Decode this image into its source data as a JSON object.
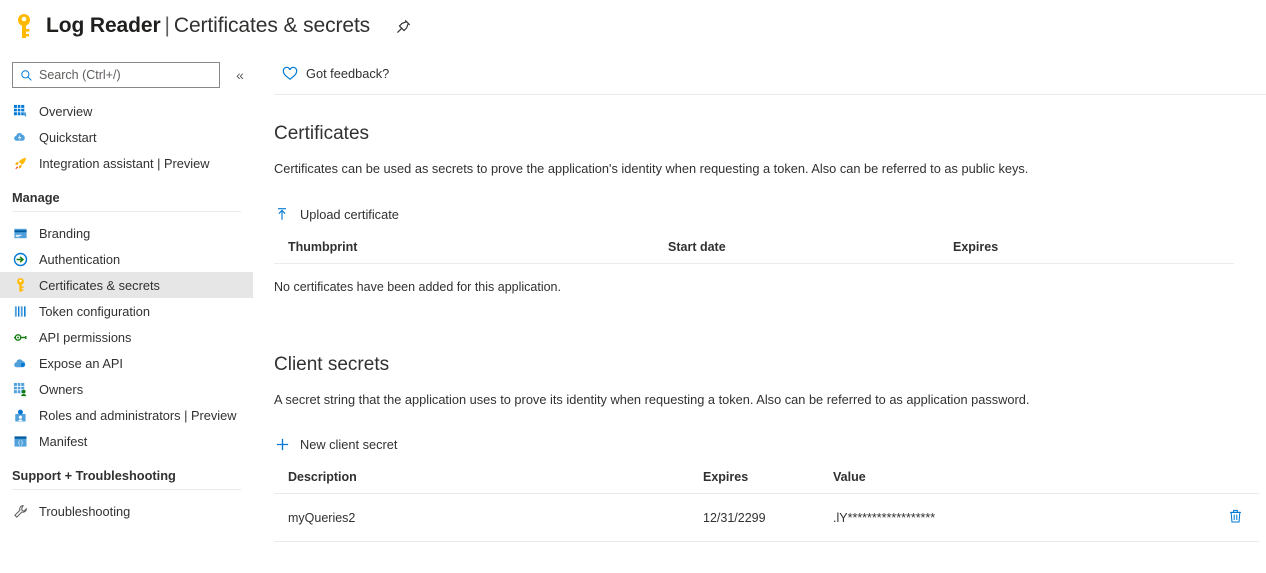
{
  "header": {
    "app_icon": "key-icon",
    "resource_name": "Log Reader",
    "separator": "|",
    "page_name": "Certificates & secrets",
    "pin_icon": "pin-icon"
  },
  "sidebar": {
    "search": {
      "placeholder": "Search (Ctrl+/)",
      "value": "",
      "icon": "search-icon"
    },
    "collapse_label": "«",
    "top_items": [
      {
        "label": "Overview",
        "icon": "overview-grid-icon",
        "selected": false
      },
      {
        "label": "Quickstart",
        "icon": "quickstart-cloud-icon",
        "selected": false
      },
      {
        "label": "Integration assistant | Preview",
        "icon": "rocket-icon",
        "selected": false
      }
    ],
    "sections": [
      {
        "title": "Manage",
        "items": [
          {
            "label": "Branding",
            "icon": "branding-card-icon",
            "selected": false
          },
          {
            "label": "Authentication",
            "icon": "authentication-arrow-icon",
            "selected": false
          },
          {
            "label": "Certificates & secrets",
            "icon": "key-icon",
            "selected": true
          },
          {
            "label": "Token configuration",
            "icon": "token-bars-icon",
            "selected": false
          },
          {
            "label": "API permissions",
            "icon": "api-permissions-key-icon",
            "selected": false
          },
          {
            "label": "Expose an API",
            "icon": "expose-api-cloud-icon",
            "selected": false
          },
          {
            "label": "Owners",
            "icon": "owners-grid-person-icon",
            "selected": false
          },
          {
            "label": "Roles and administrators | Preview",
            "icon": "roles-person-icon",
            "selected": false
          },
          {
            "label": "Manifest",
            "icon": "manifest-document-icon",
            "selected": false
          }
        ]
      },
      {
        "title": "Support + Troubleshooting",
        "items": [
          {
            "label": "Troubleshooting",
            "icon": "troubleshooting-wrench-icon",
            "selected": false
          }
        ]
      }
    ]
  },
  "command_bar": {
    "feedback_label": "Got feedback?",
    "feedback_icon": "heart-icon"
  },
  "certificates": {
    "title": "Certificates",
    "description": "Certificates can be used as secrets to prove the application's identity when requesting a token. Also can be referred to as public keys.",
    "upload_label": "Upload certificate",
    "upload_icon": "upload-icon",
    "columns": [
      "Thumbprint",
      "Start date",
      "Expires"
    ],
    "rows": [],
    "empty_message": "No certificates have been added for this application."
  },
  "client_secrets": {
    "title": "Client secrets",
    "description": "A secret string that the application uses to prove its identity when requesting a token. Also can be referred to as application password.",
    "new_secret_label": "New client secret",
    "new_secret_icon": "plus-icon",
    "columns": [
      "Description",
      "Expires",
      "Value",
      ""
    ],
    "rows": [
      {
        "description": "myQueries2",
        "expires": "12/31/2299",
        "value": ".lY******************",
        "delete_icon": "trash-icon"
      }
    ]
  },
  "colors": {
    "accent_blue": "#0078d4",
    "key_yellow": "#ffb900",
    "selected_bg": "#e6e6e6",
    "divider": "#edebe9",
    "text": "#323130"
  }
}
